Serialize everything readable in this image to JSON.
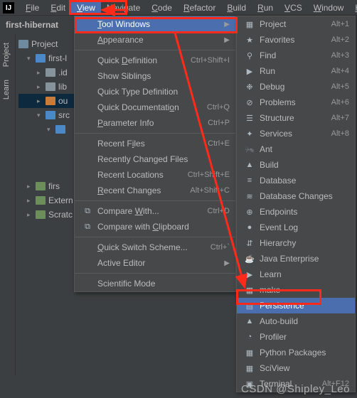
{
  "menubar": {
    "items": [
      "File",
      "Edit",
      "View",
      "Navigate",
      "Code",
      "Refactor",
      "Build",
      "Run",
      "VCS",
      "Window",
      "Help"
    ],
    "open_index": 2
  },
  "toolbar": {
    "project_name": "first-hibernat"
  },
  "sidebar_tabs": [
    "Project",
    "Learn"
  ],
  "tree": {
    "root": "Project",
    "items": [
      {
        "label": "first-l",
        "depth": 1,
        "expanded": true,
        "color": "blue"
      },
      {
        "label": ".id",
        "depth": 2,
        "expanded": false,
        "color": "gray"
      },
      {
        "label": "lib",
        "depth": 2,
        "expanded": false,
        "color": "gray"
      },
      {
        "label": "ou",
        "depth": 2,
        "expanded": false,
        "color": "orange",
        "selected": true
      },
      {
        "label": "src",
        "depth": 2,
        "expanded": true,
        "color": "blue"
      },
      {
        "label": "",
        "depth": 3,
        "expanded": true,
        "color": "blue"
      }
    ],
    "extra": [
      {
        "label": "firs",
        "icon": "sheet"
      },
      {
        "label": "Extern",
        "icon": "bars"
      },
      {
        "label": "Scratc",
        "icon": "scratch"
      }
    ]
  },
  "view_menu": {
    "groups": [
      [
        {
          "label": "Tool Windows",
          "shortcut": "",
          "submenu": true,
          "hl": true,
          "u": 0
        },
        {
          "label": "Appearance",
          "shortcut": "",
          "submenu": true,
          "u": 0
        }
      ],
      [
        {
          "label": "Quick Definition",
          "shortcut": "Ctrl+Shift+I",
          "u": 6
        },
        {
          "label": "Show Siblings",
          "shortcut": ""
        },
        {
          "label": "Quick Type Definition",
          "shortcut": ""
        },
        {
          "label": "Quick Documentation",
          "shortcut": "Ctrl+Q",
          "u": 17
        },
        {
          "label": "Parameter Info",
          "shortcut": "Ctrl+P",
          "u": 0
        }
      ],
      [
        {
          "label": "Recent Files",
          "shortcut": "Ctrl+E",
          "u": 8
        },
        {
          "label": "Recently Changed Files",
          "shortcut": ""
        },
        {
          "label": "Recent Locations",
          "shortcut": "Ctrl+Shift+E"
        },
        {
          "label": "Recent Changes",
          "shortcut": "Alt+Shift+C",
          "u": 0
        }
      ],
      [
        {
          "label": "Compare With...",
          "shortcut": "Ctrl+D",
          "u": 8,
          "icon": "diff"
        },
        {
          "label": "Compare with Clipboard",
          "shortcut": "",
          "u": 13,
          "icon": "diff"
        }
      ],
      [
        {
          "label": "Quick Switch Scheme...",
          "shortcut": "Ctrl+`",
          "u": 0
        },
        {
          "label": "Active Editor",
          "shortcut": "",
          "submenu": true
        }
      ],
      [
        {
          "label": "Scientific Mode",
          "shortcut": ""
        }
      ]
    ]
  },
  "tool_windows": [
    {
      "label": "Project",
      "shortcut": "Alt+1",
      "icon": "project"
    },
    {
      "label": "Favorites",
      "shortcut": "Alt+2",
      "icon": "star"
    },
    {
      "label": "Find",
      "shortcut": "Alt+3",
      "icon": "find"
    },
    {
      "label": "Run",
      "shortcut": "Alt+4",
      "icon": "run"
    },
    {
      "label": "Debug",
      "shortcut": "Alt+5",
      "icon": "debug"
    },
    {
      "label": "Problems",
      "shortcut": "Alt+6",
      "icon": "problems"
    },
    {
      "label": "Structure",
      "shortcut": "Alt+7",
      "icon": "structure"
    },
    {
      "label": "Services",
      "shortcut": "Alt+8",
      "icon": "services"
    },
    {
      "label": "Ant",
      "shortcut": "",
      "icon": "ant"
    },
    {
      "label": "Build",
      "shortcut": "",
      "icon": "build"
    },
    {
      "label": "Database",
      "shortcut": "",
      "icon": "database"
    },
    {
      "label": "Database Changes",
      "shortcut": "",
      "icon": "dbchanges"
    },
    {
      "label": "Endpoints",
      "shortcut": "",
      "icon": "endpoints"
    },
    {
      "label": "Event Log",
      "shortcut": "",
      "icon": "eventlog"
    },
    {
      "label": "Hierarchy",
      "shortcut": "",
      "icon": "hierarchy"
    },
    {
      "label": "Java Enterprise",
      "shortcut": "",
      "icon": "javaee"
    },
    {
      "label": "Learn",
      "shortcut": "",
      "icon": "learn"
    },
    {
      "label": "make",
      "shortcut": "",
      "icon": "make"
    },
    {
      "label": "Persistence",
      "shortcut": "",
      "icon": "persistence",
      "hl": true
    },
    {
      "label": "Auto-build",
      "shortcut": "",
      "icon": "autobuild"
    },
    {
      "label": "Profiler",
      "shortcut": "",
      "icon": "profiler"
    },
    {
      "label": "Python Packages",
      "shortcut": "",
      "icon": "pypackages"
    },
    {
      "label": "SciView",
      "shortcut": "",
      "icon": "sciview"
    },
    {
      "label": "Terminal",
      "shortcut": "Alt+F12",
      "icon": "terminal"
    }
  ],
  "watermark": "CSDN @Shipley_Leo"
}
